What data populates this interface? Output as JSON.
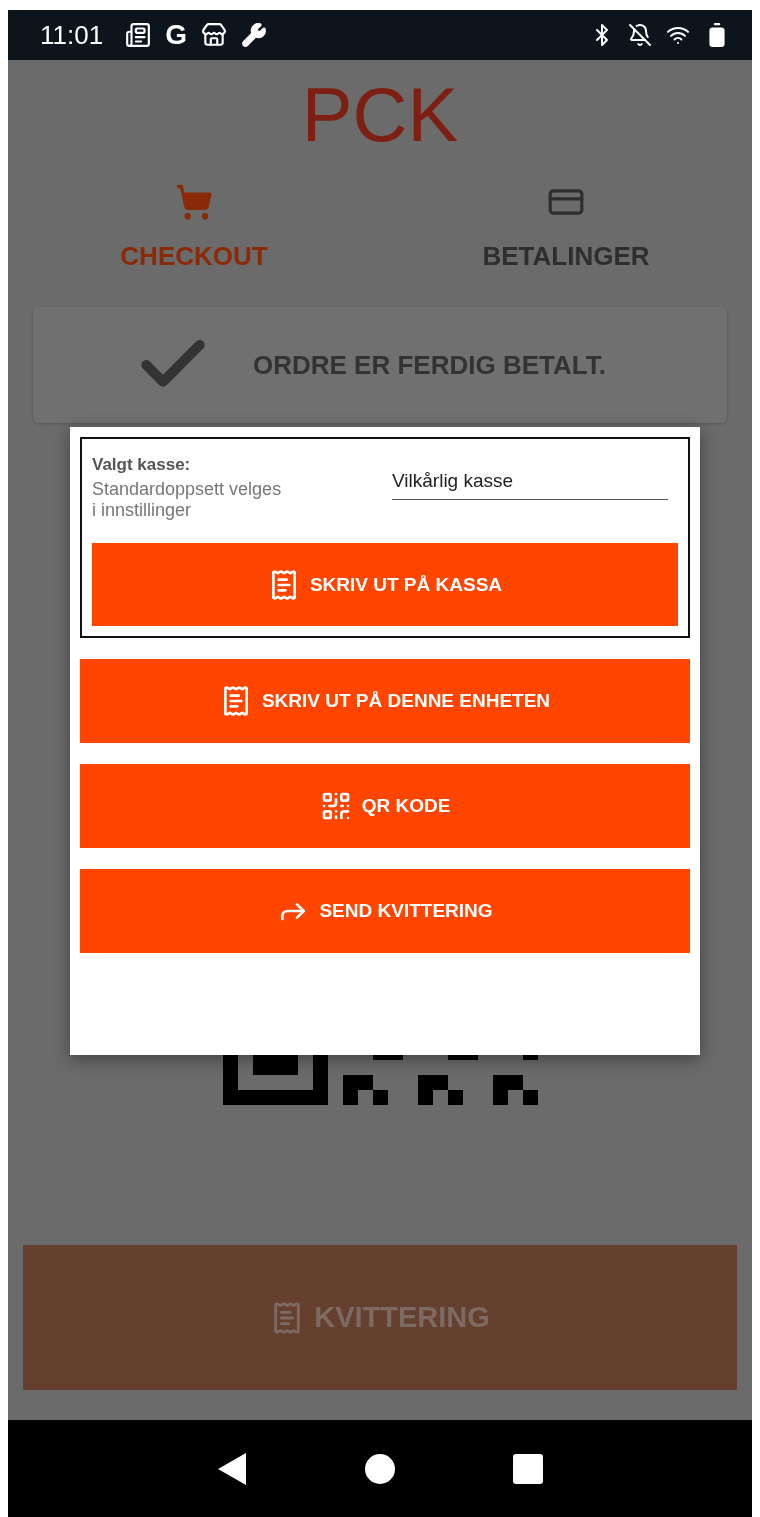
{
  "status_bar": {
    "time": "11:01",
    "app_letter": "G"
  },
  "app": {
    "title": "PCK",
    "tabs": [
      {
        "label": "CHECKOUT",
        "selected": true,
        "kind": "cart"
      },
      {
        "label": "BETALINGER",
        "selected": false,
        "kind": "card"
      }
    ],
    "status_message": "ORDRE ER FERDIG BETALT.",
    "receipt_button": "KVITTERING"
  },
  "dialog": {
    "register_label": "Valgt kasse:",
    "register_hint": "Standardoppsett velges\n i innstillinger",
    "register_value": "Vilkårlig kasse",
    "print_register_button": "SKRIV UT PÅ KASSA",
    "actions": [
      {
        "label": "SKRIV UT PÅ DENNE ENHETEN",
        "kind": "receipt"
      },
      {
        "label": "QR KODE",
        "kind": "qr"
      },
      {
        "label": "SEND KVITTERING",
        "kind": "share"
      }
    ]
  }
}
